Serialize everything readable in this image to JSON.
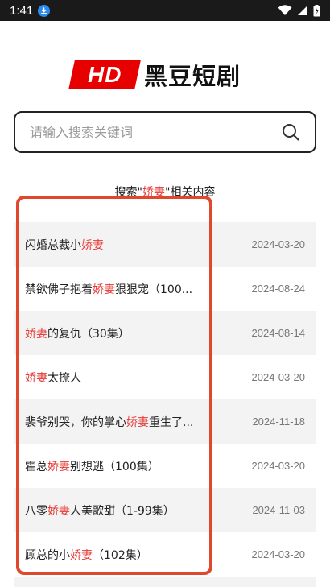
{
  "status": {
    "time": "1:41"
  },
  "logo": {
    "hd_text": "HD",
    "brand": "黑豆短剧"
  },
  "search": {
    "placeholder": "请输入搜索关键词",
    "value": ""
  },
  "results": {
    "heading_prefix": "搜索\"",
    "keyword": "娇妻",
    "heading_suffix": "\"相关内容",
    "items": [
      {
        "pre": "闪婚总裁小",
        "kw": "娇妻",
        "post": "",
        "date": "2024-03-20"
      },
      {
        "pre": "禁欲佛子抱着",
        "kw": "娇妻",
        "post": "狠狠宠（100...",
        "date": "2024-08-24"
      },
      {
        "pre": "",
        "kw": "娇妻",
        "post": "的复仇（30集）",
        "date": "2024-08-14"
      },
      {
        "pre": "",
        "kw": "娇妻",
        "post": "太撩人",
        "date": "2024-03-20"
      },
      {
        "pre": "裴爷别哭，你的掌心",
        "kw": "娇妻",
        "post": "重生了...",
        "date": "2024-11-18"
      },
      {
        "pre": "霍总",
        "kw": "娇妻",
        "post": "别想逃（100集）",
        "date": "2024-03-20"
      },
      {
        "pre": "八零",
        "kw": "娇妻",
        "post": "人美歌甜（1-99集）",
        "date": "2024-11-03"
      },
      {
        "pre": "顾总的小",
        "kw": "娇妻",
        "post": "（102集）",
        "date": "2024-03-20"
      }
    ]
  },
  "colors": {
    "accent": "#e53935",
    "frame": "#e0472c",
    "logo_red": "#e60000"
  },
  "icons": {
    "download": "download-icon",
    "wifi": "wifi-icon",
    "signal": "signal-icon",
    "battery": "battery-icon",
    "search": "search-icon"
  }
}
